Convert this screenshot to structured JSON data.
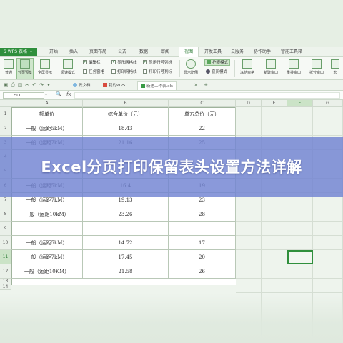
{
  "menubar": {
    "app_badge": "S WPS 表格",
    "tabs": [
      "开始",
      "插入",
      "页面布局",
      "公式",
      "数据",
      "审阅",
      "视图",
      "开发工具",
      "云服务",
      "协作助手",
      "智能工具箱"
    ],
    "active_tab": "视图"
  },
  "ribbon": {
    "normal": "普通",
    "page_break_preview": "分页预览",
    "full_screen": "全屏显示",
    "reading_mode": "阅读模式",
    "edit_bar": "编辑栏",
    "task_pane": "任务窗格",
    "show_gridlines": "显示网格线",
    "print_gridlines": "打印网格线",
    "show_row_col_headers": "显示行号列标",
    "print_row_col_headers": "打印行号列标",
    "show_ratio": "显示比例",
    "eye_protection": "护眼模式",
    "night_mode": "夜间模式",
    "freeze_panes": "冻结窗格",
    "new_window": "新建窗口",
    "rearrange_windows": "重排窗口",
    "split_window": "拆分窗口",
    "macro": "宏"
  },
  "docbar": {
    "tabs": [
      "云文档",
      "我的WPS",
      "新建工作表.xls"
    ],
    "active_tab": "新建工作表.xls"
  },
  "formulabar": {
    "cell_ref": "F11",
    "zoom_icon": "🔍",
    "fx_symbol": "fx",
    "content": ""
  },
  "sheet": {
    "columns": [
      "A",
      "B",
      "C",
      "D",
      "E",
      "F",
      "G"
    ],
    "selected_column": "F",
    "rows": [
      "1",
      "2",
      "3",
      "4",
      "5",
      "6",
      "7",
      "8",
      "9",
      "10",
      "11",
      "12",
      "13",
      "14"
    ],
    "selected_row": "11",
    "header": [
      "额单价",
      "综合单价（元）",
      "单方总价（元）"
    ],
    "data": [
      [
        "一般（运距5kM）",
        "18.43",
        "22"
      ],
      [
        "一般（运距7kM）",
        "21.16",
        "25"
      ],
      [
        "",
        "",
        ""
      ],
      [
        "",
        "",
        ""
      ],
      [
        "一般（运距5kM）",
        "16.4",
        "19"
      ],
      [
        "一般（运距7kM）",
        "19.13",
        "23"
      ],
      [
        "一般（运距10kM）",
        "23.26",
        "28"
      ],
      [
        "",
        "",
        ""
      ],
      [
        "一般（运距5kM）",
        "14.72",
        "17"
      ],
      [
        "一般（运距7kM）",
        "17.45",
        "20"
      ],
      [
        "一般（运距10KM）",
        "21.58",
        "26"
      ]
    ]
  },
  "banner": {
    "title": "Excel分页打印保留表头设置方法详解"
  },
  "colors": {
    "accent": "#2f8f3c",
    "banner": "#7083d2",
    "sheet_bg": "#eef4ed"
  }
}
